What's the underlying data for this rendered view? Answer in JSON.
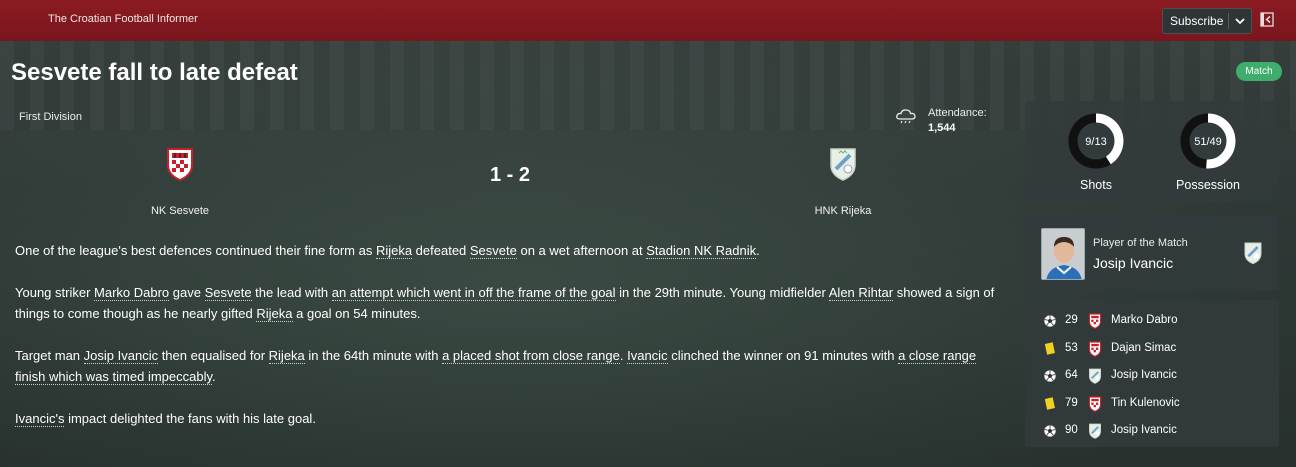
{
  "app": {
    "brand": "The Croatian Football Informer",
    "subscribe_label": "Subscribe"
  },
  "article": {
    "headline": "Sesvete fall to late defeat",
    "badge": "Match"
  },
  "match": {
    "competition": "First Division",
    "attendance_label": "Attendance:",
    "attendance_value": "1,544",
    "score": "1 - 2",
    "home_team": "NK Sesvete",
    "away_team": "HNK Rijeka"
  },
  "report": {
    "p1": [
      {
        "t": "One of the league's best defences continued their fine form as "
      },
      {
        "t": "Rijeka",
        "link": true
      },
      {
        "t": " defeated "
      },
      {
        "t": "Sesvete",
        "link": true
      },
      {
        "t": " on a wet afternoon at "
      },
      {
        "t": "Stadion NK Radnik",
        "link": true
      },
      {
        "t": "."
      }
    ],
    "p2": [
      {
        "t": "Young striker "
      },
      {
        "t": "Marko Dabro",
        "link": true
      },
      {
        "t": " gave "
      },
      {
        "t": "Sesvete",
        "link": true
      },
      {
        "t": " the lead with "
      },
      {
        "t": "an attempt which went in off the frame of the goal",
        "link": true
      },
      {
        "t": " in the 29th minute. Young midfielder "
      },
      {
        "t": "Alen Rihtar",
        "link": true
      },
      {
        "t": " showed a sign of things to come though as he nearly gifted "
      },
      {
        "t": "Rijeka",
        "link": true
      },
      {
        "t": " a goal on 54 minutes."
      }
    ],
    "p3": [
      {
        "t": "Target man "
      },
      {
        "t": "Josip Ivancic",
        "link": true
      },
      {
        "t": " then equalised for "
      },
      {
        "t": "Rijeka",
        "link": true
      },
      {
        "t": " in the 64th minute with "
      },
      {
        "t": "a placed shot from close range",
        "link": true
      },
      {
        "t": ". "
      },
      {
        "t": "Ivancic",
        "link": true
      },
      {
        "t": " clinched the winner on 91 minutes with "
      },
      {
        "t": "a close range finish which was timed impeccably",
        "link": true
      },
      {
        "t": "."
      }
    ],
    "p4": [
      {
        "t": "Ivancic's",
        "link": true
      },
      {
        "t": " impact delighted the fans with his late goal."
      }
    ]
  },
  "stats": {
    "shots": {
      "label": "Shots",
      "text": "9/13",
      "home": 9,
      "away": 13
    },
    "possession": {
      "label": "Possession",
      "text": "51/49",
      "home": 51,
      "away": 49
    }
  },
  "potm": {
    "label": "Player of the Match",
    "name": "Josip Ivancic"
  },
  "events": [
    {
      "type": "goal",
      "minute": "29",
      "team": "home",
      "player": "Marko Dabro"
    },
    {
      "type": "yellow",
      "minute": "53",
      "team": "home",
      "player": "Dajan Simac"
    },
    {
      "type": "goal",
      "minute": "64",
      "team": "away",
      "player": "Josip Ivancic"
    },
    {
      "type": "yellow",
      "minute": "79",
      "team": "home",
      "player": "Tin Kulenovic"
    },
    {
      "type": "goal",
      "minute": "90",
      "team": "away",
      "player": "Josip Ivancic"
    }
  ],
  "colors": {
    "topbar": "#8b1b22",
    "badge": "#3fae6c",
    "donut_home": "#ffffff",
    "donut_away": "#111111",
    "yellow_card": "#f0d020",
    "home_crest": "#c8202a",
    "away_crest": "#e8f0e6"
  }
}
